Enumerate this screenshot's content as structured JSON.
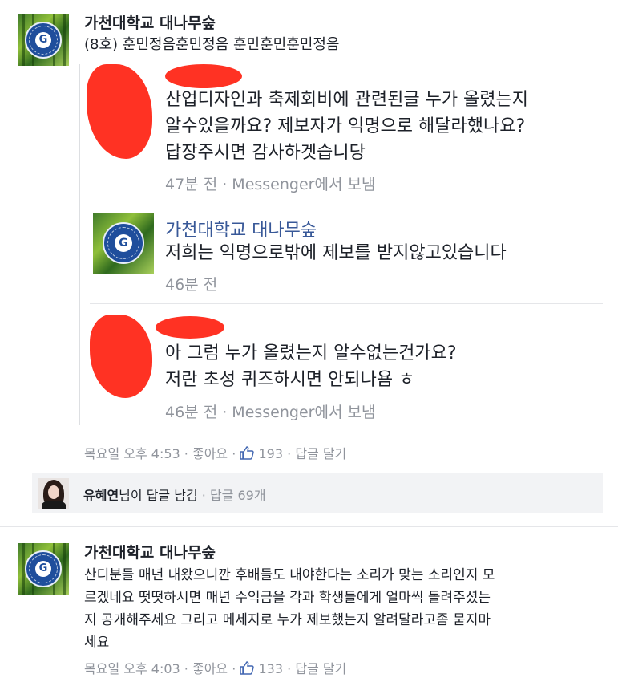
{
  "post1": {
    "page_name": "가천대학교 대나무숲",
    "text": "(8호) 훈민정음훈민정음 훈민훈민훈민정음"
  },
  "quoted": {
    "msg1": {
      "lines": [
        "산업디자인과 축제회비에 관련된글 누가 올렸는지",
        "알수있을까요? 제보자가 익명으로 해달라했나요?",
        "답장주시면 감사하겟습니당"
      ],
      "meta": "47분 전 · Messenger에서 보냄"
    },
    "msg2": {
      "sender": "가천대학교 대나무숲",
      "text": "저희는 익명으로밖에 제보를 받지않고있습니다",
      "meta": "46분 전"
    },
    "msg3": {
      "lines": [
        "아 그럼 누가 올렸는지 알수없는건가요?",
        "저란 초성 퀴즈하시면 안되나욤 ㅎ"
      ],
      "meta": "46분 전 · Messenger에서 보냄"
    }
  },
  "post1_footer": {
    "time": "목요일 오후 4:53",
    "like": "좋아요",
    "like_count": "193",
    "reply": "답글 달기"
  },
  "reply_summary": {
    "name": "유혜연",
    "suffix": "님이 답글 남김",
    "replies": "답글 69개"
  },
  "post2": {
    "page_name": "가천대학교 대나무숲",
    "lines": [
      "산디분들 매년 내왔으니깐 후배들도 내야한다는 소리가 맞는 소리인지 모",
      "르겠네요 떳떳하시면 매년 수익금을 각과 학생들에게 얼마씩 돌려주셨는",
      "지 공개해주세요 그리고 메세지로 누가 제보했는지 알려달라고좀 묻지마",
      "세요"
    ],
    "time": "목요일 오후 4:03",
    "like": "좋아요",
    "like_count": "133",
    "reply": "답글 달기"
  },
  "colors": {
    "link_blue": "#385898",
    "meta_gray": "#90949c",
    "like_blue": "#4267b2",
    "redaction_red": "#ff2a1a"
  },
  "icons": {
    "like": "thumbs-up-icon",
    "logo": "gachon-university-seal-icon"
  }
}
